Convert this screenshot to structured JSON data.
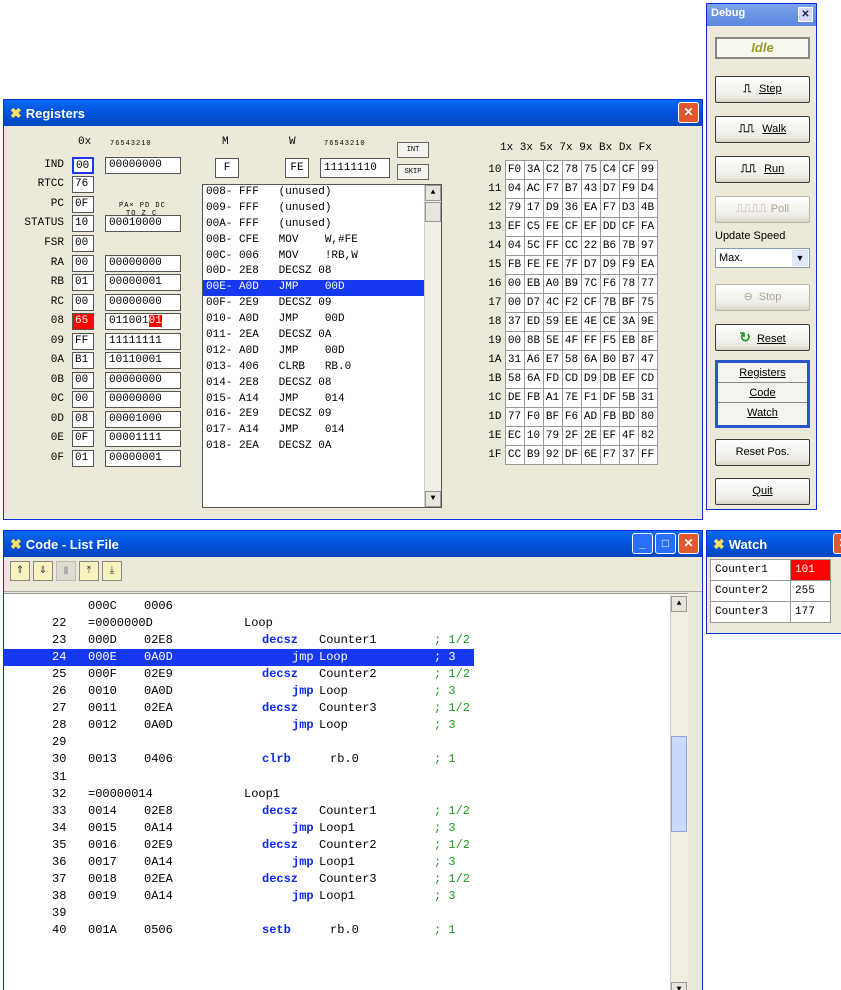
{
  "registers": {
    "title": "Registers",
    "hdr_0x": "0x",
    "hdr_bits": "76543210",
    "hdr_m": "M",
    "hdr_w": "W",
    "hdr_bits2": "76543210",
    "int_btn": "INT",
    "skip_btn": "SKIP",
    "m_val": "F",
    "w_val": "FE",
    "w_bits": "11111110",
    "status_hdr1": "PA× PD DC",
    "status_hdr2": "TO Z C",
    "fsr_hdr": "76543210",
    "rows": [
      {
        "name": "IND",
        "hex": "00",
        "bits": "00000000"
      },
      {
        "name": "RTCC",
        "hex": "76",
        "bits": ""
      },
      {
        "name": "PC",
        "hex": "0F",
        "bits": ""
      },
      {
        "name": "STATUS",
        "hex": "10",
        "bits": "00010000"
      },
      {
        "name": "FSR",
        "hex": "00",
        "bits": ""
      },
      {
        "name": "RA",
        "hex": "00",
        "bits": "00000000"
      },
      {
        "name": "RB",
        "hex": "01",
        "bits": "00000001"
      },
      {
        "name": "RC",
        "hex": "00",
        "bits": "00000000"
      },
      {
        "name": "08",
        "hex": "65",
        "bits": "011001",
        "bits_hl": "01"
      },
      {
        "name": "09",
        "hex": "FF",
        "bits": "11111111"
      },
      {
        "name": "0A",
        "hex": "B1",
        "bits": "10110001"
      },
      {
        "name": "0B",
        "hex": "00",
        "bits": "00000000"
      },
      {
        "name": "0C",
        "hex": "00",
        "bits": "00000000"
      },
      {
        "name": "0D",
        "hex": "08",
        "bits": "00001000"
      },
      {
        "name": "0E",
        "hex": "0F",
        "bits": "00001111"
      },
      {
        "name": "0F",
        "hex": "01",
        "bits": "00000001"
      }
    ],
    "code_lines": [
      "008- FFF   (unused)",
      "009- FFF   (unused)",
      "00A- FFF   (unused)",
      "00B- CFE   MOV    W,#FE",
      "00C- 006   MOV    !RB,W",
      "00D- 2E8   DECSZ 08",
      "00E- A0D   JMP    00D",
      "00F- 2E9   DECSZ 09",
      "010- A0D   JMP    00D",
      "011- 2EA   DECSZ 0A",
      "012- A0D   JMP    00D",
      "013- 406   CLRB   RB.0",
      "014- 2E8   DECSZ 08",
      "015- A14   JMP    014",
      "016- 2E9   DECSZ 09",
      "017- A14   JMP    014",
      "018- 2EA   DECSZ 0A"
    ],
    "code_selected": 6,
    "hex_header": "1x 3x 5x 7x 9x Bx Dx Fx",
    "hex_rows": [
      {
        "r": "10",
        "v": [
          "F0",
          "3A",
          "C2",
          "78",
          "75",
          "C4",
          "CF",
          "99"
        ]
      },
      {
        "r": "11",
        "v": [
          "04",
          "AC",
          "F7",
          "B7",
          "43",
          "D7",
          "F9",
          "D4"
        ]
      },
      {
        "r": "12",
        "v": [
          "79",
          "17",
          "D9",
          "36",
          "EA",
          "F7",
          "D3",
          "4B"
        ]
      },
      {
        "r": "13",
        "v": [
          "EF",
          "C5",
          "FE",
          "CF",
          "EF",
          "DD",
          "CF",
          "FA"
        ]
      },
      {
        "r": "14",
        "v": [
          "04",
          "5C",
          "FF",
          "CC",
          "22",
          "B6",
          "7B",
          "97"
        ]
      },
      {
        "r": "15",
        "v": [
          "FB",
          "FE",
          "FE",
          "7F",
          "D7",
          "D9",
          "F9",
          "EA"
        ]
      },
      {
        "r": "16",
        "v": [
          "00",
          "EB",
          "A0",
          "B9",
          "7C",
          "F6",
          "78",
          "77"
        ]
      },
      {
        "r": "17",
        "v": [
          "00",
          "D7",
          "4C",
          "F2",
          "CF",
          "7B",
          "BF",
          "75"
        ]
      },
      {
        "r": "18",
        "v": [
          "37",
          "ED",
          "59",
          "EE",
          "4E",
          "CE",
          "3A",
          "9E"
        ]
      },
      {
        "r": "19",
        "v": [
          "00",
          "8B",
          "5E",
          "4F",
          "FF",
          "F5",
          "EB",
          "8F"
        ]
      },
      {
        "r": "1A",
        "v": [
          "31",
          "A6",
          "E7",
          "58",
          "6A",
          "B0",
          "B7",
          "47"
        ]
      },
      {
        "r": "1B",
        "v": [
          "58",
          "6A",
          "FD",
          "CD",
          "D9",
          "DB",
          "EF",
          "CD"
        ]
      },
      {
        "r": "1C",
        "v": [
          "DE",
          "FB",
          "A1",
          "7E",
          "F1",
          "DF",
          "5B",
          "31"
        ]
      },
      {
        "r": "1D",
        "v": [
          "77",
          "F0",
          "BF",
          "F6",
          "AD",
          "FB",
          "BD",
          "80"
        ]
      },
      {
        "r": "1E",
        "v": [
          "EC",
          "10",
          "79",
          "2F",
          "2E",
          "EF",
          "4F",
          "82"
        ]
      },
      {
        "r": "1F",
        "v": [
          "CC",
          "B9",
          "92",
          "DF",
          "6E",
          "F7",
          "37",
          "FF"
        ]
      }
    ]
  },
  "debug": {
    "title": "Debug",
    "state": "Idle",
    "step": "Step",
    "walk": "Walk",
    "run": "Run",
    "poll": "Poll",
    "update_speed_label": "Update Speed",
    "speed_value": "Max.",
    "stop": "Stop",
    "reset": "Reset",
    "view_registers": "Registers",
    "view_code": "Code",
    "view_watch": "Watch",
    "reset_pos": "Reset Pos.",
    "quit": "Quit"
  },
  "codelist": {
    "title": "Code - List File",
    "lines": [
      {
        "n": "",
        "addr": "000C",
        "op": "0006",
        "kw": "",
        "arg": "",
        "cm": "",
        "label": ""
      },
      {
        "n": "22",
        "addr": "=0000000D",
        "op": "",
        "kw": "",
        "arg": "",
        "cm": "",
        "label": "Loop"
      },
      {
        "n": "23",
        "addr": "000D",
        "op": "02E8",
        "kw": "decsz",
        "arg": "Counter1",
        "cm": "; 1/2",
        "label": ""
      },
      {
        "n": "24",
        "addr": "000E",
        "op": "0A0D",
        "kw": "jmp",
        "arg": "Loop",
        "cm": "; 3",
        "label": "",
        "sel": true
      },
      {
        "n": "25",
        "addr": "000F",
        "op": "02E9",
        "kw": "decsz",
        "arg": "Counter2",
        "cm": "; 1/2",
        "label": ""
      },
      {
        "n": "26",
        "addr": "0010",
        "op": "0A0D",
        "kw": "jmp",
        "arg": "Loop",
        "cm": "; 3",
        "label": ""
      },
      {
        "n": "27",
        "addr": "0011",
        "op": "02EA",
        "kw": "decsz",
        "arg": "Counter3",
        "cm": "; 1/2",
        "label": ""
      },
      {
        "n": "28",
        "addr": "0012",
        "op": "0A0D",
        "kw": "jmp",
        "arg": "Loop",
        "cm": "; 3",
        "label": ""
      },
      {
        "n": "29",
        "addr": "",
        "op": "",
        "kw": "",
        "arg": "",
        "cm": "",
        "label": ""
      },
      {
        "n": "30",
        "addr": "0013",
        "op": "0406",
        "kw": "clrb",
        "arg": "rb.0",
        "cm": "; 1",
        "label": ""
      },
      {
        "n": "31",
        "addr": "",
        "op": "",
        "kw": "",
        "arg": "",
        "cm": "",
        "label": ""
      },
      {
        "n": "32",
        "addr": "=00000014",
        "op": "",
        "kw": "",
        "arg": "",
        "cm": "",
        "label": "Loop1"
      },
      {
        "n": "33",
        "addr": "0014",
        "op": "02E8",
        "kw": "decsz",
        "arg": "Counter1",
        "cm": "; 1/2",
        "label": ""
      },
      {
        "n": "34",
        "addr": "0015",
        "op": "0A14",
        "kw": "jmp",
        "arg": "Loop1",
        "cm": "; 3",
        "label": ""
      },
      {
        "n": "35",
        "addr": "0016",
        "op": "02E9",
        "kw": "decsz",
        "arg": "Counter2",
        "cm": "; 1/2",
        "label": ""
      },
      {
        "n": "36",
        "addr": "0017",
        "op": "0A14",
        "kw": "jmp",
        "arg": "Loop1",
        "cm": "; 3",
        "label": ""
      },
      {
        "n": "37",
        "addr": "0018",
        "op": "02EA",
        "kw": "decsz",
        "arg": "Counter3",
        "cm": "; 1/2",
        "label": ""
      },
      {
        "n": "38",
        "addr": "0019",
        "op": "0A14",
        "kw": "jmp",
        "arg": "Loop1",
        "cm": "; 3",
        "label": ""
      },
      {
        "n": "39",
        "addr": "",
        "op": "",
        "kw": "",
        "arg": "",
        "cm": "",
        "label": ""
      },
      {
        "n": "40",
        "addr": "001A",
        "op": "0506",
        "kw": "setb",
        "arg": "rb.0",
        "cm": "; 1",
        "label": ""
      }
    ]
  },
  "watch": {
    "title": "Watch",
    "items": [
      {
        "name": "Counter1",
        "value": "101",
        "changed": true
      },
      {
        "name": "Counter2",
        "value": "255",
        "changed": false
      },
      {
        "name": "Counter3",
        "value": "177",
        "changed": false
      }
    ]
  },
  "colors": {
    "selection": "#1538f0",
    "changed": "#ff0000",
    "keyword": "#0b2ae8",
    "comment": "#1d9c1d"
  }
}
